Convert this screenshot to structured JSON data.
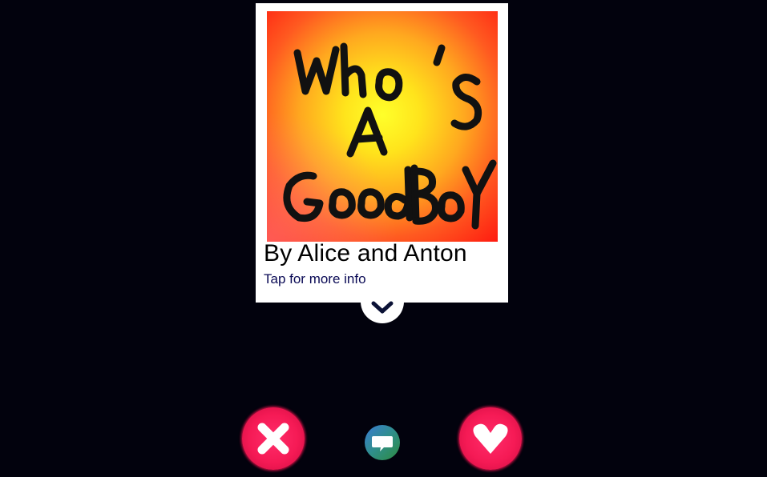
{
  "card": {
    "artwork_text": "WHO'S A GOOD BOY",
    "artist": "By Alice and Anton",
    "more_info": "Tap for more info"
  },
  "icons": {
    "expand": "chevron-down-icon",
    "reject": "close-icon",
    "chat": "chat-bubble-icon",
    "like": "heart-icon"
  },
  "colors": {
    "background": "#02020d",
    "action_red": "#f51a55",
    "link": "#0a0a55"
  }
}
